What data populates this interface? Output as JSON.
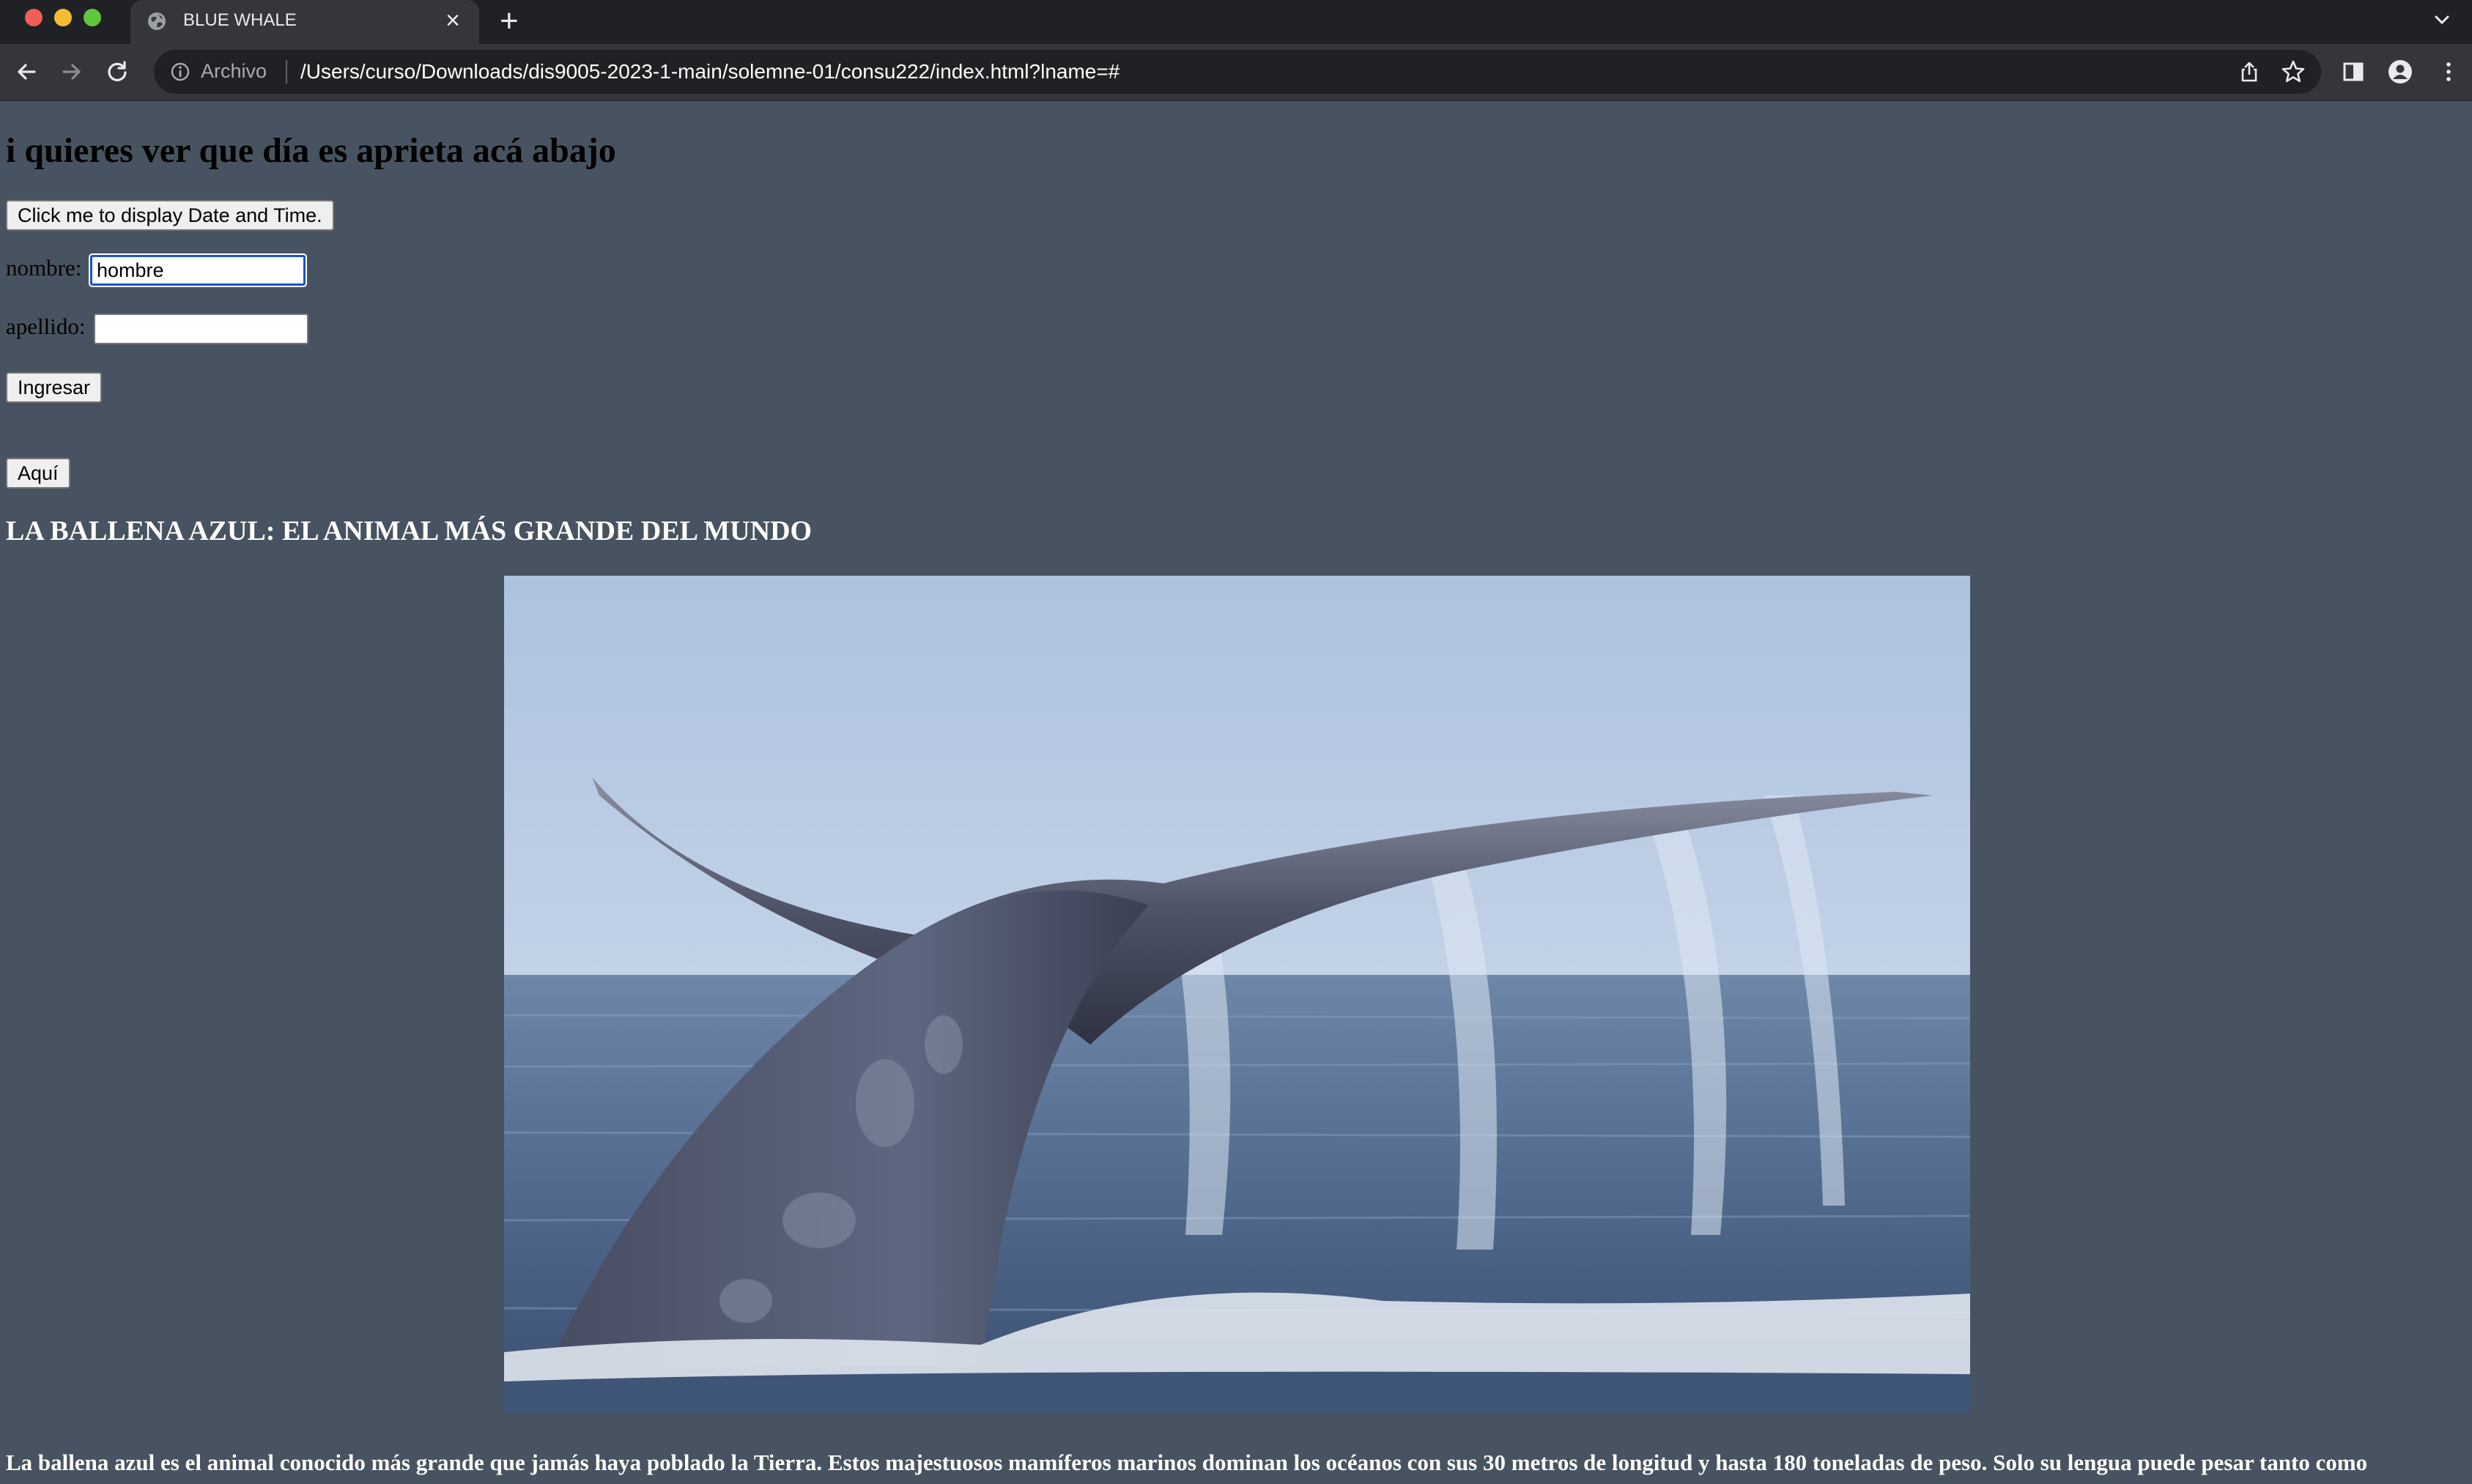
{
  "browser": {
    "tab_title": "BLUE WHALE",
    "tab_close": "×",
    "new_tab": "+",
    "scheme_label": "Archivo",
    "url": "/Users/curso/Downloads/dis9005-2023-1-main/solemne-01/consu222/index.html?lname=#"
  },
  "page": {
    "heading": "i quieres ver que día es aprieta acá abajo",
    "date_button": "Click me to display Date and Time.",
    "form": {
      "nombre_label": "nombre:",
      "nombre_value": "hombre",
      "apellido_label": "apellido:",
      "apellido_value": "",
      "submit_label": "Ingresar"
    },
    "aqui_button": "Aquí",
    "section_title": "LA BALLENA AZUL: EL ANIMAL MÁS GRANDE DEL MUNDO",
    "image_subject": "blue whale tail fluke above ocean",
    "paragraph": "La ballena azul es el animal conocido más grande que jamás haya poblado la Tierra. Estos majestuosos mamíferos marinos dominan los océanos con sus 30 metros de longitud y hasta 180 toneladas de peso. Solo su lengua puede pesar tanto como"
  },
  "colors": {
    "page_background": "#475360",
    "tabbar": "#1f2124",
    "toolbar": "#35363a",
    "omnibox": "#202124",
    "focus_ring": "#1a54c9"
  },
  "icons": [
    "globe-icon",
    "close-icon",
    "plus-icon",
    "chevron-down-icon",
    "back-icon",
    "forward-icon",
    "reload-icon",
    "info-icon",
    "share-icon",
    "star-icon",
    "side-panel-icon",
    "profile-icon",
    "kebab-menu-icon"
  ]
}
